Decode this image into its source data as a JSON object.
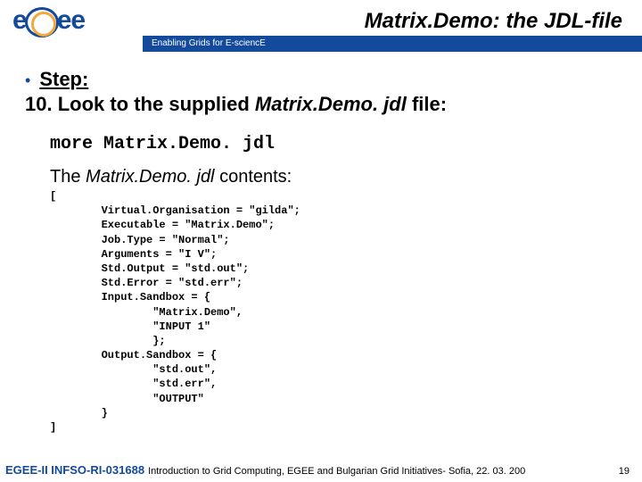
{
  "header": {
    "title": "Matrix.Demo: the JDL-file",
    "tagline": "Enabling Grids for E-sciencE",
    "logo_text_left": "e",
    "logo_text_right": "ee"
  },
  "content": {
    "step_label": "Step:",
    "step_number_line": "10. Look to the supplied ",
    "step_filename": "Matrix.Demo. jdl",
    "step_tail": " file:",
    "command": "more Matrix.Demo. jdl",
    "contents_prefix": "The ",
    "contents_filename": "Matrix.Demo. jdl",
    "contents_suffix": " contents:",
    "code": "[\n        Virtual.Organisation = \"gilda\";\n        Executable = \"Matrix.Demo\";\n        Job.Type = \"Normal\";\n        Arguments = \"I V\";\n        Std.Output = \"std.out\";\n        Std.Error = \"std.err\";\n        Input.Sandbox = {\n                \"Matrix.Demo\",\n                \"INPUT 1\"\n                };\n        Output.Sandbox = {\n                \"std.out\",\n                \"std.err\",\n                \"OUTPUT\"\n        }\n]"
  },
  "footer": {
    "project": "EGEE-II INFSO-RI-031688",
    "caption": "Introduction to Grid Computing, EGEE and Bulgarian Grid Initiatives- Sofia, 22. 03. 200",
    "page": "19"
  }
}
